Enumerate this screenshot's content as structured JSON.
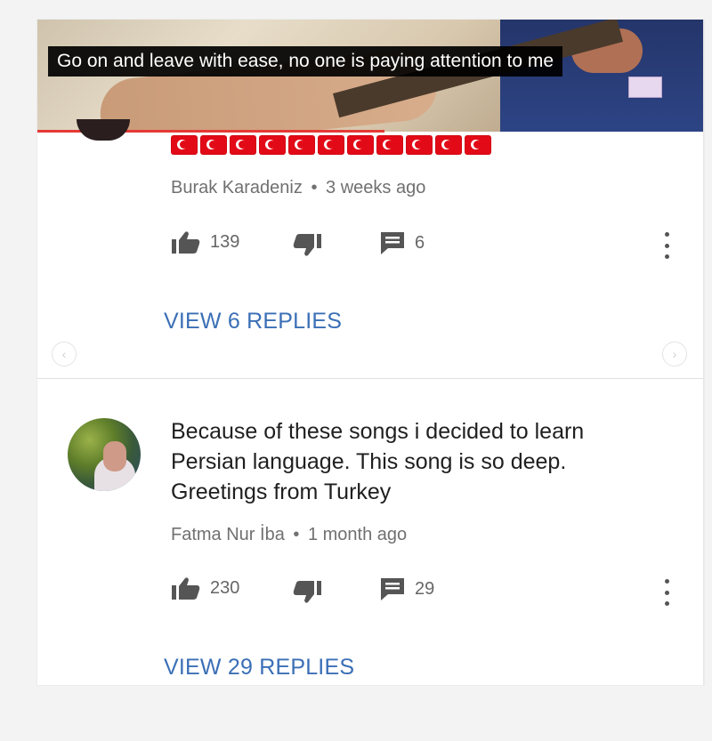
{
  "video": {
    "subtitle": "Go on and leave with ease, no one is paying attention to me"
  },
  "comments": [
    {
      "author": "Burak Karadeniz",
      "separator": "•",
      "time": "3 weeks ago",
      "flag_count": 11,
      "likes": "139",
      "reply_count": "6",
      "view_replies": "VIEW 6 REPLIES"
    },
    {
      "text": "Because of these songs i decided to learn Persian language.  This song is so deep. Greetings from Turkey",
      "author": "Fatma Nur İba",
      "separator": "•",
      "time": "1 month ago",
      "likes": "230",
      "reply_count": "29",
      "view_replies": "VIEW 29 REPLIES"
    }
  ],
  "colors": {
    "link": "#3b6fb6",
    "progress": "#e53935",
    "flag": "#e30a17"
  },
  "icons": [
    "thumbs-up-icon",
    "thumbs-down-icon",
    "reply-comment-icon",
    "more-vert-icon",
    "chevron-left-icon",
    "chevron-right-icon"
  ],
  "nav": {
    "prev": "‹",
    "next": "›"
  }
}
